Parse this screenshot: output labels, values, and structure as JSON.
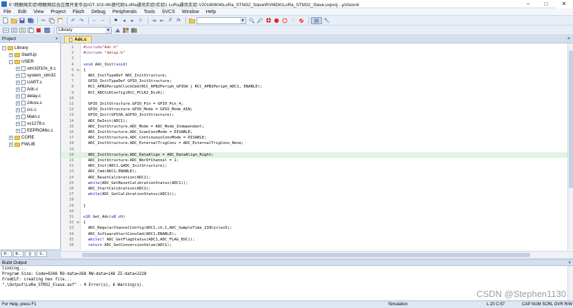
{
  "window": {
    "title": "E:\\物联网实验\\物联网综合应用开发平台IOT-103-06\\源代码\\LoRa通讯实验\\实验1 LoRa通讯实验-V20180604\\LoRa_STM32_Slave\\RVMDK\\LoRa_STM32_Slave.uvproj - µVision4",
    "minimize": "–",
    "maximize": "□",
    "close": "✕"
  },
  "menu": [
    "File",
    "Edit",
    "View",
    "Project",
    "Flash",
    "Debug",
    "Peripherals",
    "Tools",
    "SVCS",
    "Window",
    "Help"
  ],
  "toolbar": {
    "target_select": "Library"
  },
  "project_panel": {
    "title": "Project",
    "close": "×",
    "tree": [
      {
        "label": "Library",
        "indent": 0,
        "type": "root",
        "expander": "−"
      },
      {
        "label": "StartUp",
        "indent": 1,
        "type": "folder",
        "expander": "+"
      },
      {
        "label": "USER",
        "indent": 1,
        "type": "folder",
        "expander": "−"
      },
      {
        "label": "stm32f10x_it.c",
        "indent": 2,
        "type": "file",
        "expander": "+"
      },
      {
        "label": "system_stm32",
        "indent": 2,
        "type": "file",
        "expander": "+"
      },
      {
        "label": "UART.c",
        "indent": 2,
        "type": "file",
        "expander": "+"
      },
      {
        "label": "Adc.c",
        "indent": 2,
        "type": "file",
        "expander": "+"
      },
      {
        "label": "delay.c",
        "indent": 2,
        "type": "file",
        "expander": "+"
      },
      {
        "label": "24cxx.c",
        "indent": 2,
        "type": "file",
        "expander": "+"
      },
      {
        "label": "crc.c",
        "indent": 2,
        "type": "file",
        "expander": "+"
      },
      {
        "label": "Main.c",
        "indent": 2,
        "type": "file",
        "expander": "+"
      },
      {
        "label": "sx1278.c",
        "indent": 2,
        "type": "file",
        "expander": "+"
      },
      {
        "label": "EEPROMic.c",
        "indent": 2,
        "type": "file",
        "expander": "+"
      },
      {
        "label": "CORE",
        "indent": 1,
        "type": "folder",
        "expander": "+"
      },
      {
        "label": "FWLIB",
        "indent": 1,
        "type": "folder",
        "expander": "+"
      }
    ],
    "tabs": [
      "P...",
      "B...",
      "{}",
      "0.."
    ]
  },
  "editor": {
    "active_tab": "Adc.c",
    "close": "×",
    "lines": [
      {
        "n": "1",
        "text": "#include\"Adc.h\""
      },
      {
        "n": "2",
        "text": "#include \"delay.h\""
      },
      {
        "n": "3",
        "text": ""
      },
      {
        "n": "4",
        "text": "void Adc_Init(void)"
      },
      {
        "n": "5",
        "text": "{"
      },
      {
        "n": "6",
        "text": "  ADC_InitTypeDef ADC_InitStructure;"
      },
      {
        "n": "7",
        "text": "  GPIO_InitTypeDef GPIO_InitStructure;"
      },
      {
        "n": "8",
        "text": "  RCC_APB2PeriphClockCmd(RCC_APB2Periph_GPIOA | RCC_APB2Periph_ADC1, ENABLE);"
      },
      {
        "n": "9",
        "text": "  RCC_ADCCLKConfig(RCC_PCLK2_Div6);"
      },
      {
        "n": "10",
        "text": ""
      },
      {
        "n": "11",
        "text": "  GPIO_InitStructure.GPIO_Pin = GPIO_Pin_4;"
      },
      {
        "n": "12",
        "text": "  GPIO_InitStructure.GPIO_Mode = GPIO_Mode_AIN;"
      },
      {
        "n": "13",
        "text": "  GPIO_Init(GPIOA,&GPIO_InitStructure);"
      },
      {
        "n": "14",
        "text": "  ADC_DeInit(ADC1);"
      },
      {
        "n": "15",
        "text": "  ADC_InitStructure.ADC_Mode = ADC_Mode_Independent;"
      },
      {
        "n": "16",
        "text": "  ADC_InitStructure.ADC_ScanConvMode = DISABLE;"
      },
      {
        "n": "17",
        "text": "  ADC_InitStructure.ADC_ContinuousConvMode = DISABLE;"
      },
      {
        "n": "18",
        "text": "  ADC_InitStructure.ADC_ExternalTrigConv = ADC_ExternalTrigConv_None;"
      },
      {
        "n": "19",
        "text": ""
      },
      {
        "n": "20",
        "text": "  ADC_InitStructure.ADC_DataAlign = ADC_DataAlign_Right;"
      },
      {
        "n": "21",
        "text": "  ADC_InitStructure.ADC_NbrOfChannel = 1;"
      },
      {
        "n": "22",
        "text": "  ADC_Init(ADC1,&ADC_InitStructure);"
      },
      {
        "n": "23",
        "text": "  ADC_Cmd(ADC1,ENABLE);"
      },
      {
        "n": "24",
        "text": "  ADC_ResetCalibration(ADC1);"
      },
      {
        "n": "25",
        "text": "  while(ADC_GetResetCalibrationStatus(ADC1));"
      },
      {
        "n": "26",
        "text": "  ADC_StartCalibration(ADC1);"
      },
      {
        "n": "27",
        "text": "  while(ADC_GetCalibrationStatus(ADC1));"
      },
      {
        "n": "28",
        "text": ""
      },
      {
        "n": "29",
        "text": "}"
      },
      {
        "n": "30",
        "text": ""
      },
      {
        "n": "31",
        "text": "u16 Get_Adc(u8 ch)"
      },
      {
        "n": "32",
        "text": "{"
      },
      {
        "n": "33",
        "text": "  ADC_RegularChannelConfig(ADC1,ch,1,ADC_SampleTime_239Cycles5);"
      },
      {
        "n": "34",
        "text": "  ADC_SoftwareStartConvCmd(ADC1,ENABLE);"
      },
      {
        "n": "35",
        "text": "  while(! ADC_GetFlagStatus(ADC1,ADC_FLAG_EOC));"
      },
      {
        "n": "36",
        "text": "  return ADC_GetConversionValue(ADC1);"
      }
    ],
    "highlighted_line": "20"
  },
  "build_output": {
    "title": "Build Output",
    "close": "×",
    "lines": [
      "linking...",
      "Program Size: Code=9248 RO-data=268 RW-data=148 ZI-data=2228",
      "FromELF: creating hex file...",
      "\".\\Output\\LoRa_STM32_Slave.axf\" - 0 Error(s), 6 Warning(s)."
    ]
  },
  "status_bar": {
    "help": "For Help, press F1",
    "mode": "Simulation",
    "position": "L:20 C:57",
    "keys": "CAP  NUM  SCRL  OVR  R/W"
  },
  "watermark": "CSDN @Stephen1130"
}
